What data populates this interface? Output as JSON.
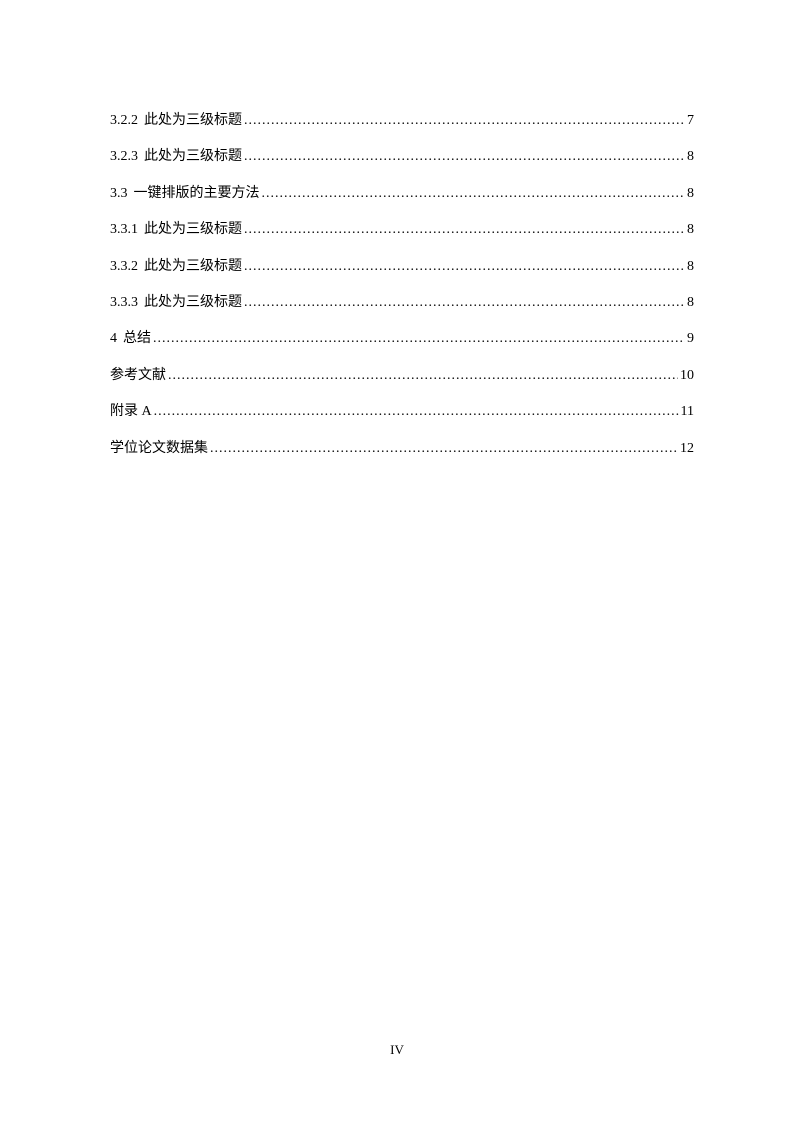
{
  "toc": [
    {
      "number": "3.2.2",
      "title": "此处为三级标题",
      "page": "7"
    },
    {
      "number": "3.2.3",
      "title": "此处为三级标题",
      "page": "8"
    },
    {
      "number": "3.3",
      "title": "一键排版的主要方法",
      "page": "8"
    },
    {
      "number": "3.3.1",
      "title": "此处为三级标题",
      "page": "8"
    },
    {
      "number": "3.3.2",
      "title": "此处为三级标题",
      "page": "8"
    },
    {
      "number": "3.3.3",
      "title": "此处为三级标题",
      "page": "8"
    },
    {
      "number": "4",
      "title": "总结",
      "page": "9"
    },
    {
      "number": "",
      "title": "参考文献",
      "page": "10"
    },
    {
      "number": "",
      "title": "附录 A",
      "page": "11"
    },
    {
      "number": "",
      "title": "学位论文数据集",
      "page": "12"
    }
  ],
  "page_number": "IV"
}
